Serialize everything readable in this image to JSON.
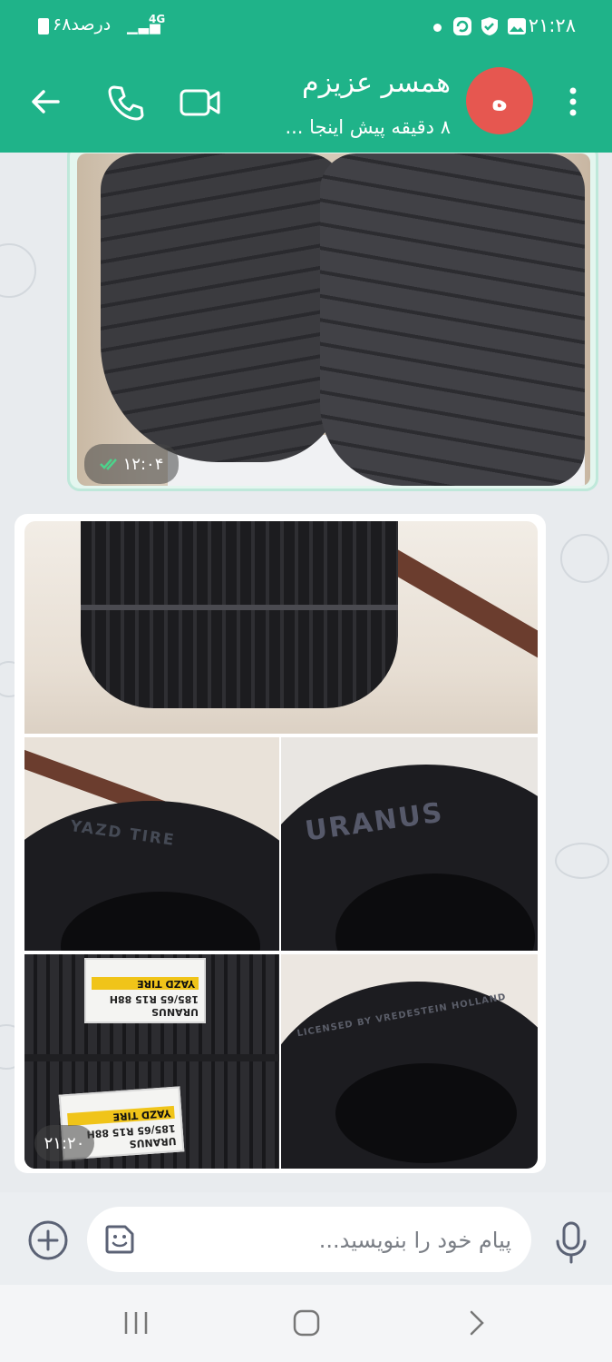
{
  "status_bar": {
    "time": "۲۱:۲۸",
    "battery": "۶۸درصد",
    "network": "4G"
  },
  "header": {
    "contact_name": "همسر عزیزم",
    "contact_status": "۸ دقیقه پیش اینجا ...",
    "avatar_initial": "ه",
    "icons": [
      "back-arrow-icon",
      "phone-icon",
      "video-camera-icon",
      "more-vertical-icon"
    ]
  },
  "messages": [
    {
      "direction": "outgoing",
      "type": "image",
      "time": "۱۲:۰۴",
      "read": true
    },
    {
      "direction": "incoming",
      "type": "image-album",
      "image_count": 5,
      "time": "۲۱:۲۰",
      "photo_texts": {
        "sidewall_brand": "YAZD TIRE",
        "sidewall_model": "URANUS",
        "sidewall_license": "LICENSED BY VREDESTEIN HOLLAND",
        "label_model": "URANUS",
        "label_size": "185/65 R15 88H",
        "label_brand": "YAZD TIRE"
      }
    }
  ],
  "composer": {
    "placeholder": "پیام خود را بنویسید..."
  },
  "colors": {
    "header_green": "#1fb389",
    "avatar_red": "#e65750",
    "outgoing_bubble": "#e4f6ef",
    "read_check": "#4cd38b"
  }
}
